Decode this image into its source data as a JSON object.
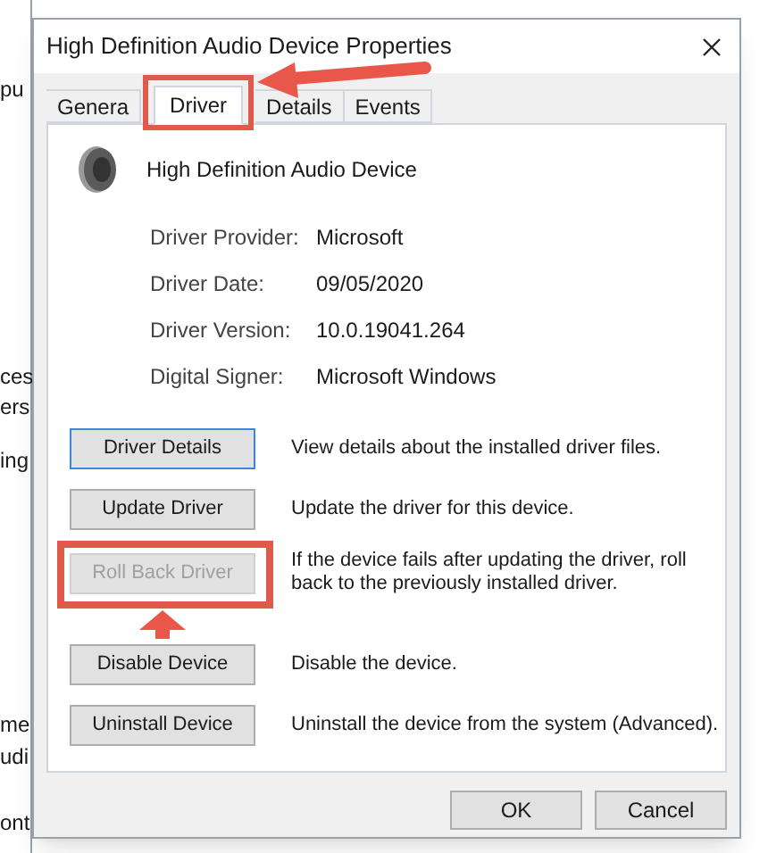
{
  "background_window": {
    "fragments": [
      "pu",
      "ces",
      "ers",
      "ing",
      "me",
      "udi",
      "ont"
    ]
  },
  "window": {
    "title": "High Definition Audio Device Properties"
  },
  "tabs": [
    {
      "label": "Genera",
      "selected": false,
      "highlighted": false
    },
    {
      "label": "Driver",
      "selected": true,
      "highlighted": true
    },
    {
      "label": "Details",
      "selected": false,
      "highlighted": false
    },
    {
      "label": "Events",
      "selected": false,
      "highlighted": false
    }
  ],
  "device": {
    "name": "High Definition Audio Device"
  },
  "properties": [
    {
      "label": "Driver Provider:",
      "value": "Microsoft"
    },
    {
      "label": "Driver Date:",
      "value": "09/05/2020"
    },
    {
      "label": "Driver Version:",
      "value": "10.0.19041.264"
    },
    {
      "label": "Digital Signer:",
      "value": "Microsoft Windows"
    }
  ],
  "actions": [
    {
      "label": "Driver Details",
      "description": "View details about the installed driver files.",
      "disabled": false,
      "focused": true,
      "highlighted": false
    },
    {
      "label": "Update Driver",
      "description": "Update the driver for this device.",
      "disabled": false,
      "focused": false,
      "highlighted": false
    },
    {
      "label": "Roll Back Driver",
      "description": "If the device fails after updating the driver, roll back to the previously installed driver.",
      "disabled": true,
      "focused": false,
      "highlighted": true
    },
    {
      "label": "Disable Device",
      "description": "Disable the device.",
      "disabled": false,
      "focused": false,
      "highlighted": false
    },
    {
      "label": "Uninstall Device",
      "description": "Uninstall the device from the system (Advanced).",
      "disabled": false,
      "focused": false,
      "highlighted": false
    }
  ],
  "buttons": [
    "OK",
    "Cancel"
  ]
}
